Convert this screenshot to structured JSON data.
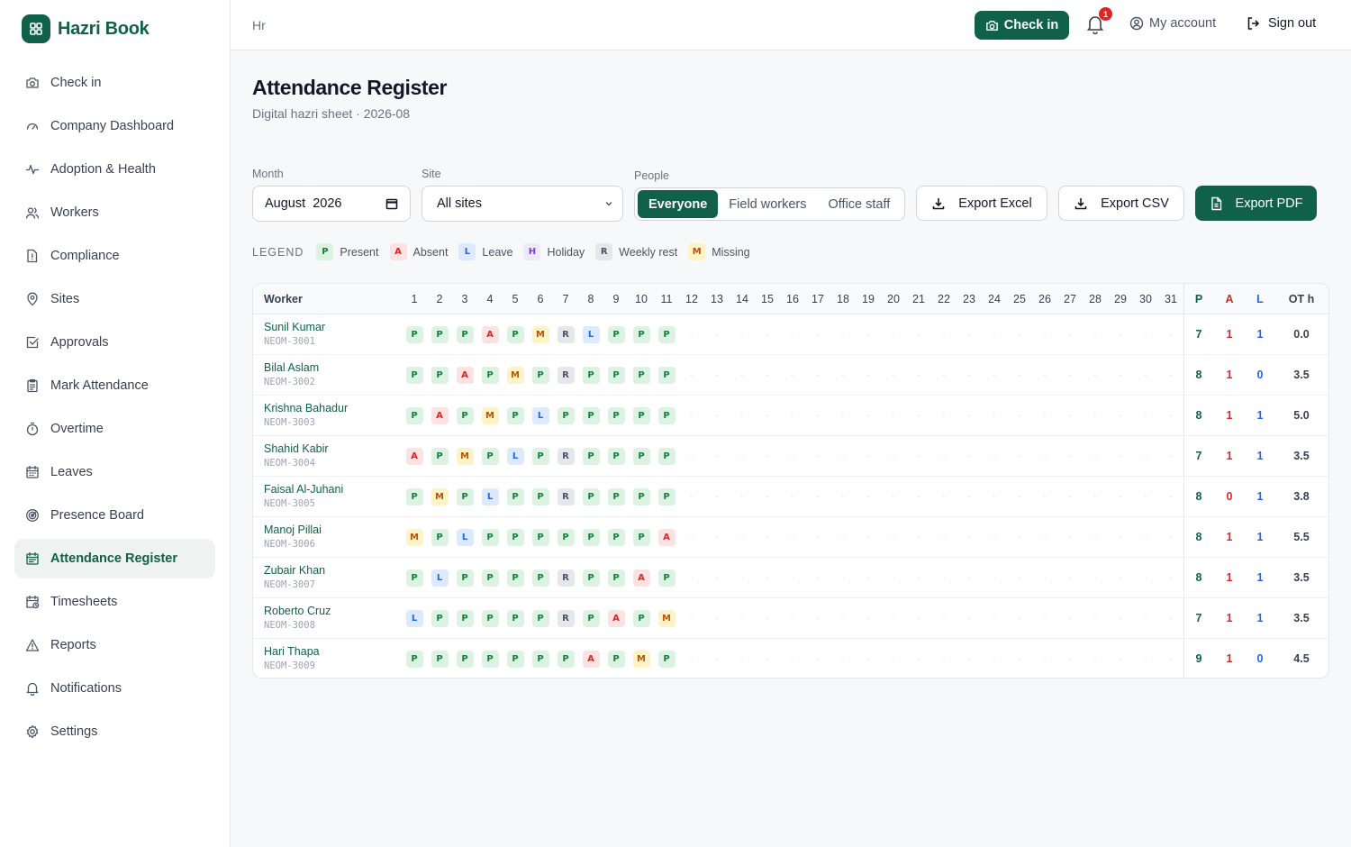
{
  "app": {
    "name": "Hazri Book"
  },
  "sidebar": {
    "items": [
      {
        "label": "Check in",
        "icon": "camera-icon"
      },
      {
        "label": "Company Dashboard",
        "icon": "gauge-icon"
      },
      {
        "label": "Adoption & Health",
        "icon": "activity-icon"
      },
      {
        "label": "Workers",
        "icon": "users-icon"
      },
      {
        "label": "Compliance",
        "icon": "file-alert-icon"
      },
      {
        "label": "Sites",
        "icon": "map-pin-icon"
      },
      {
        "label": "Approvals",
        "icon": "check-square-icon"
      },
      {
        "label": "Mark Attendance",
        "icon": "clipboard-icon"
      },
      {
        "label": "Overtime",
        "icon": "timer-icon"
      },
      {
        "label": "Leaves",
        "icon": "calendar-icon"
      },
      {
        "label": "Presence Board",
        "icon": "radar-icon"
      },
      {
        "label": "Attendance Register",
        "icon": "calendar-grid-icon",
        "active": true
      },
      {
        "label": "Timesheets",
        "icon": "calendar-clock-icon"
      },
      {
        "label": "Reports",
        "icon": "alert-triangle-icon"
      },
      {
        "label": "Notifications",
        "icon": "bell-icon"
      },
      {
        "label": "Settings",
        "icon": "gear-icon"
      }
    ]
  },
  "topbar": {
    "breadcrumb": "Hr",
    "checkin_label": "Check in",
    "notification_count": "1",
    "account_label": "My account",
    "signout_label": "Sign out"
  },
  "header": {
    "title": "Attendance Register",
    "subtitle": "Digital hazri sheet · 2026-08"
  },
  "filters": {
    "month_label": "Month",
    "month_value": "August  2026",
    "site_label": "Site",
    "site_value": "All sites",
    "people_label": "People",
    "people_options": [
      "Everyone",
      "Field workers",
      "Office staff"
    ],
    "people_selected": "Everyone"
  },
  "actions": {
    "export_excel": "Export Excel",
    "export_csv": "Export CSV",
    "export_pdf": "Export PDF"
  },
  "legend": {
    "title": "LEGEND",
    "items": [
      {
        "code": "P",
        "label": "Present"
      },
      {
        "code": "A",
        "label": "Absent"
      },
      {
        "code": "L",
        "label": "Leave"
      },
      {
        "code": "H",
        "label": "Holiday"
      },
      {
        "code": "R",
        "label": "Weekly rest"
      },
      {
        "code": "M",
        "label": "Missing"
      }
    ]
  },
  "colors": {
    "brand": "#116149",
    "absent": "#dc2626",
    "leave": "#2563eb"
  },
  "table": {
    "worker_header": "Worker",
    "days": [
      "1",
      "2",
      "3",
      "4",
      "5",
      "6",
      "7",
      "8",
      "9",
      "10",
      "11",
      "12",
      "13",
      "14",
      "15",
      "16",
      "17",
      "18",
      "19",
      "20",
      "21",
      "22",
      "23",
      "24",
      "25",
      "26",
      "27",
      "28",
      "29",
      "30",
      "31"
    ],
    "summary_headers": [
      "P",
      "A",
      "L",
      "OT h"
    ],
    "empty_mark": "·",
    "rows": [
      {
        "name": "Sunil Kumar",
        "id": "NEOM-3001",
        "marks": [
          "P",
          "P",
          "P",
          "A",
          "P",
          "M",
          "R",
          "L",
          "P",
          "P",
          "P"
        ],
        "p": "7",
        "a": "1",
        "l": "1",
        "ot": "0.0"
      },
      {
        "name": "Bilal Aslam",
        "id": "NEOM-3002",
        "marks": [
          "P",
          "P",
          "A",
          "P",
          "M",
          "P",
          "R",
          "P",
          "P",
          "P",
          "P"
        ],
        "p": "8",
        "a": "1",
        "l": "0",
        "ot": "3.5"
      },
      {
        "name": "Krishna Bahadur",
        "id": "NEOM-3003",
        "marks": [
          "P",
          "A",
          "P",
          "M",
          "P",
          "L",
          "P",
          "P",
          "P",
          "P",
          "P"
        ],
        "p": "8",
        "a": "1",
        "l": "1",
        "ot": "5.0"
      },
      {
        "name": "Shahid Kabir",
        "id": "NEOM-3004",
        "marks": [
          "A",
          "P",
          "M",
          "P",
          "L",
          "P",
          "R",
          "P",
          "P",
          "P",
          "P"
        ],
        "p": "7",
        "a": "1",
        "l": "1",
        "ot": "3.5"
      },
      {
        "name": "Faisal Al-Juhani",
        "id": "NEOM-3005",
        "marks": [
          "P",
          "M",
          "P",
          "L",
          "P",
          "P",
          "R",
          "P",
          "P",
          "P",
          "P"
        ],
        "p": "8",
        "a": "0",
        "l": "1",
        "ot": "3.8"
      },
      {
        "name": "Manoj Pillai",
        "id": "NEOM-3006",
        "marks": [
          "M",
          "P",
          "L",
          "P",
          "P",
          "P",
          "P",
          "P",
          "P",
          "P",
          "A"
        ],
        "p": "8",
        "a": "1",
        "l": "1",
        "ot": "5.5"
      },
      {
        "name": "Zubair Khan",
        "id": "NEOM-3007",
        "marks": [
          "P",
          "L",
          "P",
          "P",
          "P",
          "P",
          "R",
          "P",
          "P",
          "A",
          "P"
        ],
        "p": "8",
        "a": "1",
        "l": "1",
        "ot": "3.5"
      },
      {
        "name": "Roberto Cruz",
        "id": "NEOM-3008",
        "marks": [
          "L",
          "P",
          "P",
          "P",
          "P",
          "P",
          "R",
          "P",
          "A",
          "P",
          "M"
        ],
        "p": "7",
        "a": "1",
        "l": "1",
        "ot": "3.5"
      },
      {
        "name": "Hari Thapa",
        "id": "NEOM-3009",
        "marks": [
          "P",
          "P",
          "P",
          "P",
          "P",
          "P",
          "P",
          "A",
          "P",
          "M",
          "P"
        ],
        "p": "9",
        "a": "1",
        "l": "0",
        "ot": "4.5"
      }
    ]
  }
}
